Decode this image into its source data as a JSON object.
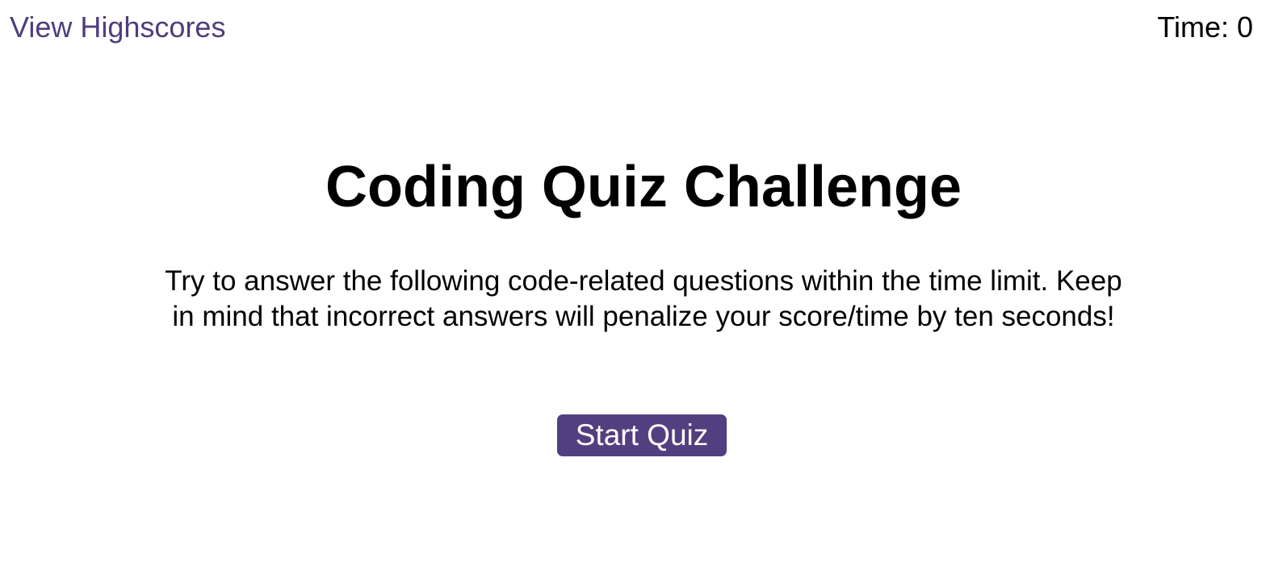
{
  "header": {
    "highscores_label": "View Highscores",
    "timer_label": "Time: 0"
  },
  "main": {
    "title": "Coding Quiz Challenge",
    "intro": "Try to answer the following code-related questions within the time limit. Keep in mind that incorrect answers will penalize your score/time by ten seconds!",
    "start_label": "Start Quiz"
  },
  "colors": {
    "accent": "#523f7f",
    "link": "#4f3d7c",
    "text": "#000000",
    "background": "#ffffff"
  }
}
